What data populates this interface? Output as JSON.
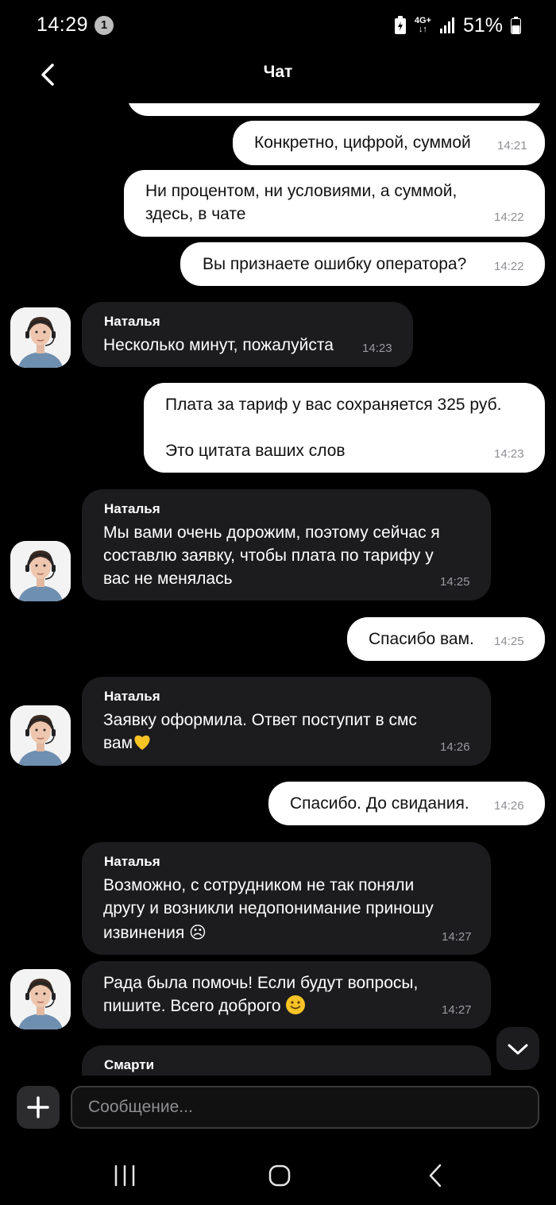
{
  "status_bar": {
    "time": "14:29",
    "notification_count": "1",
    "network_top": "4G+",
    "network_bottom": "↓↑",
    "battery_percent": "51%"
  },
  "header": {
    "title": "Чат"
  },
  "messages": [
    {
      "direction": "out",
      "text": "Конкретно, цифрой, суммой",
      "time": "14:21"
    },
    {
      "direction": "out",
      "text_lines": [
        "Ни процентом, ни условиями, а суммой,",
        "здесь, в чате"
      ],
      "time": "14:22"
    },
    {
      "direction": "out",
      "text": "Вы признаете ошибку оператора?",
      "time": "14:22"
    },
    {
      "direction": "in",
      "sender": "Наталья",
      "text": "Несколько минут, пожалуйста",
      "time": "14:23"
    },
    {
      "direction": "out",
      "text_lines": [
        "Плата за тариф у вас сохраняется 325 руб.",
        "Это цитата ваших слов"
      ],
      "time": "14:23"
    },
    {
      "direction": "in",
      "sender": "Наталья",
      "text_lines": [
        "Мы вами очень дорожим, поэтому сейчас я",
        "составлю заявку, чтобы плата по тарифу у",
        "вас не менялась"
      ],
      "time": "14:25"
    },
    {
      "direction": "out",
      "text": "Спасибо вам.",
      "time": "14:25"
    },
    {
      "direction": "in",
      "sender": "Наталья",
      "text_lines": [
        "Заявку оформила. Ответ поступит в смс",
        "вам"
      ],
      "emoji": "yellow-heart",
      "time": "14:26"
    },
    {
      "direction": "out",
      "text": "Спасибо. До свидания.",
      "time": "14:26"
    },
    {
      "direction": "in",
      "sender": "Наталья",
      "text_lines": [
        "Возможно, с сотрудником не так поняли",
        "другу и возникли недопонимание приношу",
        "извинения ☹"
      ],
      "time": "14:27"
    },
    {
      "direction": "in",
      "text_lines": [
        "Рада была помочь! Если будут вопросы,",
        "пишите. Всего доброго"
      ],
      "emoji": "smiling-face",
      "time": "14:27"
    },
    {
      "direction": "in",
      "sender": "Смарти"
    }
  ],
  "composer": {
    "placeholder": "Сообщение..."
  },
  "icons": {
    "back": "chevron-left-icon",
    "scroll_down": "chevron-down-icon",
    "attach": "plus-icon",
    "nav_recents": "recent-apps-icon",
    "nav_home": "home-icon",
    "nav_back": "back-icon"
  },
  "colors": {
    "background": "#000000",
    "outgoing_bubble": "#ffffff",
    "incoming_bubble": "#1c1c1e",
    "timestamp": "#8e8e93"
  }
}
